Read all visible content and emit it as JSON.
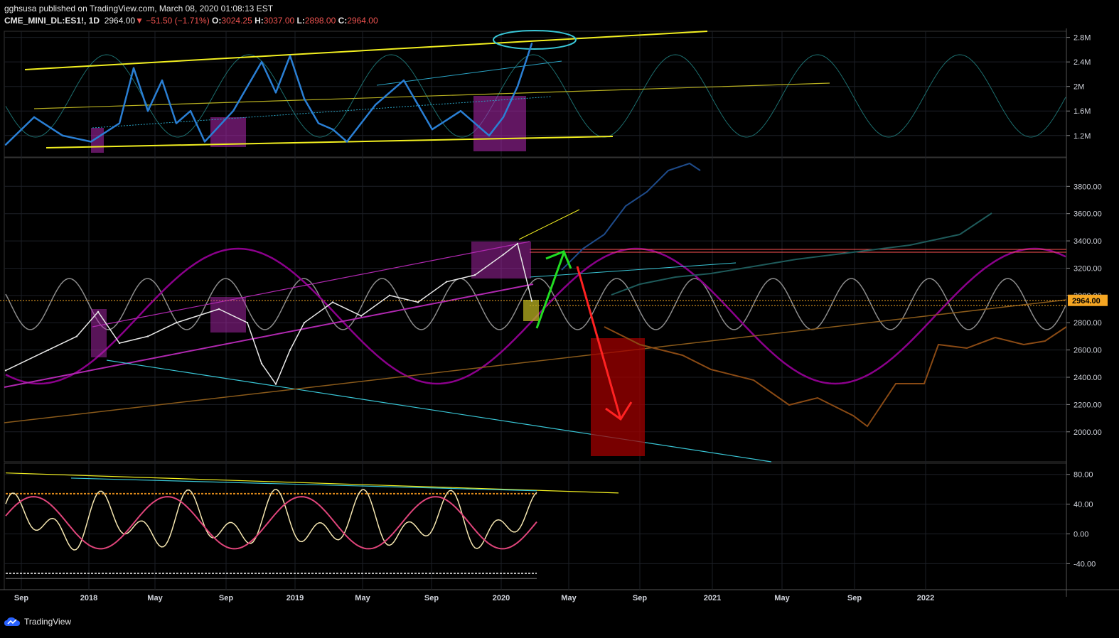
{
  "header": {
    "line1": "gghsusa published on TradingView.com, March 08, 2020 01:08:13 EST",
    "symbol": "CME_MINI_DL:ES1!, 1D",
    "last": "2964.00",
    "change": "▼ −51.50 (−1.71%)",
    "o_label": "O:",
    "o_val": "3024.25",
    "h_label": "H:",
    "h_val": "3037.00",
    "l_label": "L:",
    "l_val": "2898.00",
    "c_label": "C:",
    "c_val": "2964.00"
  },
  "brand": {
    "name": "TradingView"
  },
  "colors": {
    "background": "#000000",
    "grid": "#1c1f26",
    "yellow": "#f2ef20",
    "cyan": "#39c6d6",
    "magenta": "#b028b0",
    "purple": "#8b008b",
    "price_tag": "#f5a623",
    "green": "#22dd22",
    "red": "#ff2222",
    "blue_line": "#2a7fd4",
    "orange_proj": "#8a4a14",
    "pink": "#e0457b"
  },
  "chart_data": [
    {
      "type": "line",
      "panel": "top oscillator",
      "yaxis_ticks": [
        "2.8M",
        "2.4M",
        "2M",
        "1.6M",
        "1.2M"
      ],
      "y_values": [
        2800000,
        2400000,
        2000000,
        1600000,
        1200000
      ],
      "ylim": [
        850000,
        2900000
      ],
      "series": [
        {
          "values_x_index": [
            0,
            4,
            8,
            12,
            16,
            18,
            20,
            22,
            24,
            26,
            28,
            32,
            36,
            38,
            40,
            42,
            44,
            46,
            48,
            52,
            56,
            60,
            64,
            68,
            70,
            72,
            74
          ],
          "values": [
            1050000,
            1500000,
            1200000,
            1100000,
            1400000,
            2300000,
            1600000,
            2100000,
            1400000,
            1600000,
            1100000,
            1600000,
            2400000,
            1900000,
            2500000,
            1800000,
            1400000,
            1300000,
            1100000,
            1700000,
            2100000,
            1300000,
            1600000,
            1200000,
            1500000,
            2000000,
            2700000
          ]
        }
      ]
    },
    {
      "type": "line",
      "panel": "price",
      "yaxis_ticks": [
        "3800.00",
        "3600.00",
        "3400.00",
        "3200.00",
        "3000.00",
        "2800.00",
        "2600.00",
        "2400.00",
        "2200.00",
        "2000.00"
      ],
      "y_values": [
        3800,
        3600,
        3400,
        3200,
        3000,
        2800,
        2600,
        2400,
        2200,
        2000
      ],
      "ylim": [
        1780,
        4010
      ],
      "last_price_tag": "2964.00",
      "series": [
        {
          "values_x_index": [
            0,
            6,
            10,
            13,
            16,
            20,
            24,
            30,
            34,
            36,
            38,
            40,
            42,
            46,
            50,
            54,
            58,
            62,
            66,
            70,
            72,
            74
          ],
          "values": [
            2450,
            2600,
            2700,
            2880,
            2650,
            2700,
            2800,
            2900,
            2800,
            2500,
            2350,
            2600,
            2800,
            2950,
            2850,
            3000,
            2950,
            3100,
            3150,
            3300,
            3380,
            2960
          ]
        }
      ]
    },
    {
      "type": "line",
      "panel": "stochastic",
      "yaxis_ticks": [
        "80.00",
        "40.00",
        "0.00",
        "-40.00"
      ],
      "y_values": [
        80,
        40,
        0,
        -40
      ],
      "ylim": [
        -75,
        95
      ]
    }
  ],
  "xaxis": {
    "labels": [
      "Sep",
      "2018",
      "May",
      "Sep",
      "2019",
      "May",
      "Sep",
      "2020",
      "May",
      "Sep",
      "2021",
      "May",
      "Sep",
      "2022"
    ]
  }
}
